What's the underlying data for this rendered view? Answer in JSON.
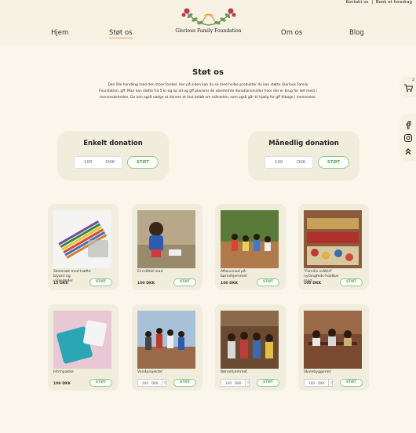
{
  "topbar": {
    "contact": "Kontakt os",
    "sep": "|",
    "book": "Book et foredrag"
  },
  "nav": {
    "home": "Hjem",
    "support": "Støt os",
    "about": "Om os",
    "blog": "Blog"
  },
  "logo": {
    "name": "Glorious Family Foundation"
  },
  "page": {
    "title": "Støt os",
    "intro": "Den lille handling med den store forskel. Her på siden kan du se med hvilke produkter du kan støtte Glorious Family Foundation, gff. Man kan støtte fra 5 kr og op ad og gff placerer de ubestemte donationsmidler hvor der er brug for det mest i menneskeheden. Du kan også vælge at donere et fast beløb om måneden, som også går til hjælp for gff tilbage i mennesker."
  },
  "donations": {
    "single": {
      "title": "Enkelt donation",
      "amount": "100",
      "currency": "DKK",
      "button": "STØT"
    },
    "monthly": {
      "title": "Månedlig donation",
      "amount": "100",
      "currency": "DKK",
      "button": "STØT"
    }
  },
  "products": [
    {
      "name": "Skolesæt med hæfte blyant og viskelæder",
      "price": "15 DKK",
      "button": "STØT"
    },
    {
      "name": "Et måltid mad",
      "price": "100 DKK",
      "button": "STØT"
    },
    {
      "name": "Aftensmad på børnehjemmet",
      "price": "100 DKK",
      "button": "STØT"
    },
    {
      "name": "\"Familie måltid\" nyfangfeds-holdbar mad",
      "price": "100 DKK",
      "button": "STØT"
    },
    {
      "name": "Intimpakke",
      "price": "100 DKK",
      "button": "STØT"
    },
    {
      "name": "Vandprojektet",
      "amount": "100",
      "currency": "DKK",
      "button": "STØT"
    },
    {
      "name": "Børnehjemmet",
      "amount": "100",
      "currency": "DKK",
      "button": "STØT"
    },
    {
      "name": "Skolebyggeriet",
      "amount": "100",
      "currency": "DKK",
      "button": "STØT"
    }
  ],
  "cart": {
    "count": "2",
    "icon": "cart-icon"
  },
  "social": {
    "icons": [
      "facebook-icon",
      "instagram-icon",
      "scroll-top-icon"
    ]
  },
  "colors": {
    "accent": "#5aa35a",
    "background": "#faf6ec",
    "panel": "#f1eddd"
  }
}
